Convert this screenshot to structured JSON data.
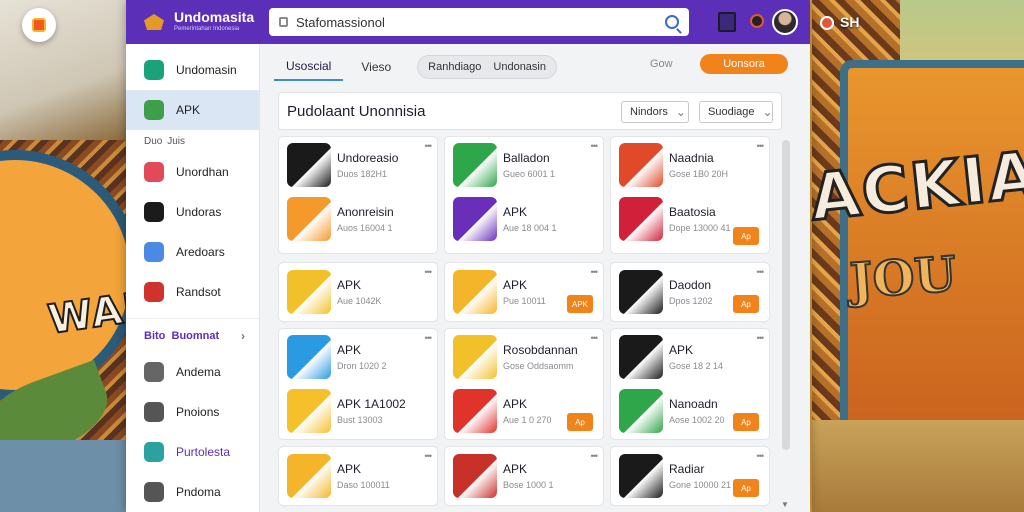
{
  "app": {
    "brand": "Undomasita",
    "brand_sub": "Pemerintahan Indonesia",
    "search_value": "Stafomassionol"
  },
  "sidebar": {
    "items_top": [
      {
        "label": "Undomasin",
        "icon": "shield-icon",
        "color": "#1aa37a"
      },
      {
        "label": "APK",
        "icon": "apk-icon",
        "color": "#3ca04a",
        "active": true
      }
    ],
    "section1": {
      "left": "Duo",
      "right": "Juis"
    },
    "items_mid": [
      {
        "label": "Unordhan",
        "icon": "camera-icon",
        "color": "#e24a5a"
      },
      {
        "label": "Undoras",
        "icon": "triangle-icon",
        "color": "#1b1b1b"
      },
      {
        "label": "Aredoars",
        "icon": "play-icon",
        "color": "#4a8ae2"
      },
      {
        "label": "Randsot",
        "icon": "flag-icon",
        "color": "#d0332c"
      }
    ],
    "section2": {
      "left": "Bito",
      "right": "Buomnat"
    },
    "items_bottom": [
      {
        "label": "Andema",
        "icon": "document-icon",
        "color": "#666"
      },
      {
        "label": "Pnoions",
        "icon": "circle-icon",
        "color": "#555"
      },
      {
        "label": "Purtolesta",
        "icon": "location-icon",
        "color": "#2aa3a0",
        "purple": true
      },
      {
        "label": "Pndoma",
        "icon": "monitor-icon",
        "color": "#555"
      }
    ]
  },
  "tabs": {
    "active": "Usoscial",
    "second": "Vieso",
    "pill_a": "Ranhdiago",
    "pill_b": "Undonasin",
    "ghost": "Gow",
    "cta": "Uonsora"
  },
  "panel": {
    "title": "Pudolaant Unonnisia",
    "select1": "Nindors",
    "select2": "Suodiage"
  },
  "cards": [
    {
      "col": 0,
      "row": 0,
      "apps": [
        {
          "name": "Undoreasio",
          "sub": "Duos 182H1",
          "icon": "apk-dark-icon",
          "color": "#1a1a1a"
        },
        {
          "name": "Anonreisin",
          "sub": "Auos 16004 1",
          "icon": "slides-icon",
          "color": "#f59a2a"
        }
      ]
    },
    {
      "col": 1,
      "row": 0,
      "apps": [
        {
          "name": "Balladon",
          "sub": "Gueo 6001 1",
          "icon": "triangle-green-icon",
          "color": "#2ea64a"
        },
        {
          "name": "APK",
          "sub": "Aue 18 004 1",
          "icon": "apk-purple-icon",
          "color": "#6a2fb8"
        }
      ]
    },
    {
      "col": 2,
      "row": 0,
      "apps": [
        {
          "name": "Naadnia",
          "sub": "Gose 1B0 20H",
          "icon": "pyramid-icon",
          "color": "#e04a2a"
        },
        {
          "name": "Baatosia",
          "sub": "Dope 13000 41",
          "icon": "swirl-icon",
          "color": "#d0203a"
        }
      ],
      "button": "Ap"
    },
    {
      "col": 0,
      "row": 1,
      "apps": [
        {
          "name": "APK",
          "sub": "Aue 1042K",
          "icon": "ring-icon",
          "color": "#f2c12a"
        }
      ]
    },
    {
      "col": 1,
      "row": 1,
      "apps": [
        {
          "name": "APK",
          "sub": "Pue 10011",
          "icon": "warning-icon",
          "color": "#f5b52a"
        }
      ],
      "button": "APK"
    },
    {
      "col": 2,
      "row": 1,
      "apps": [
        {
          "name": "Daodon",
          "sub": "Dpos 1202",
          "icon": "ak-icon",
          "color": "#1a1a1a"
        }
      ],
      "button": "Ap"
    },
    {
      "col": 0,
      "row": 2,
      "apps": [
        {
          "name": "APK",
          "sub": "Dron 1020 2",
          "icon": "camera-blue-icon",
          "color": "#2a9ae2"
        },
        {
          "name": "APK 1A1002",
          "sub": "Bust 13003",
          "icon": "character-icon",
          "color": "#f5c02a"
        }
      ]
    },
    {
      "col": 1,
      "row": 2,
      "apps": [
        {
          "name": "Rosobdannan",
          "sub": "Gose Oddsaomm",
          "icon": "no-entry-icon",
          "color": "#f2c12a"
        },
        {
          "name": "APK",
          "sub": "Aue 1 0 270",
          "icon": "flags-icon",
          "color": "#e0342a"
        }
      ],
      "button": "Ap"
    },
    {
      "col": 2,
      "row": 2,
      "apps": [
        {
          "name": "APK",
          "sub": "Gose 18 2 14",
          "icon": "a-icon",
          "color": "#1a1a1a"
        },
        {
          "name": "Nanoadn",
          "sub": "Aose 1002 20",
          "icon": "green-mountain-icon",
          "color": "#2ea64a"
        }
      ],
      "button": "Ap"
    },
    {
      "col": 0,
      "row": 3,
      "apps": [
        {
          "name": "APK",
          "sub": "Daso 100011",
          "icon": "coin-icon",
          "color": "#f5b52a"
        }
      ]
    },
    {
      "col": 1,
      "row": 3,
      "apps": [
        {
          "name": "APK",
          "sub": "Bose 1000 1",
          "icon": "fire-icon",
          "color": "#c8302a"
        }
      ]
    },
    {
      "col": 2,
      "row": 3,
      "apps": [
        {
          "name": "Radiar",
          "sub": "Gone 10000 21",
          "icon": "slash-icon",
          "color": "#1a1a1a"
        }
      ],
      "button": "Ap"
    }
  ],
  "background": {
    "word_left": "WAR",
    "word_right": "ACKIA",
    "word_right2": "JOU",
    "top_right": "SH"
  }
}
